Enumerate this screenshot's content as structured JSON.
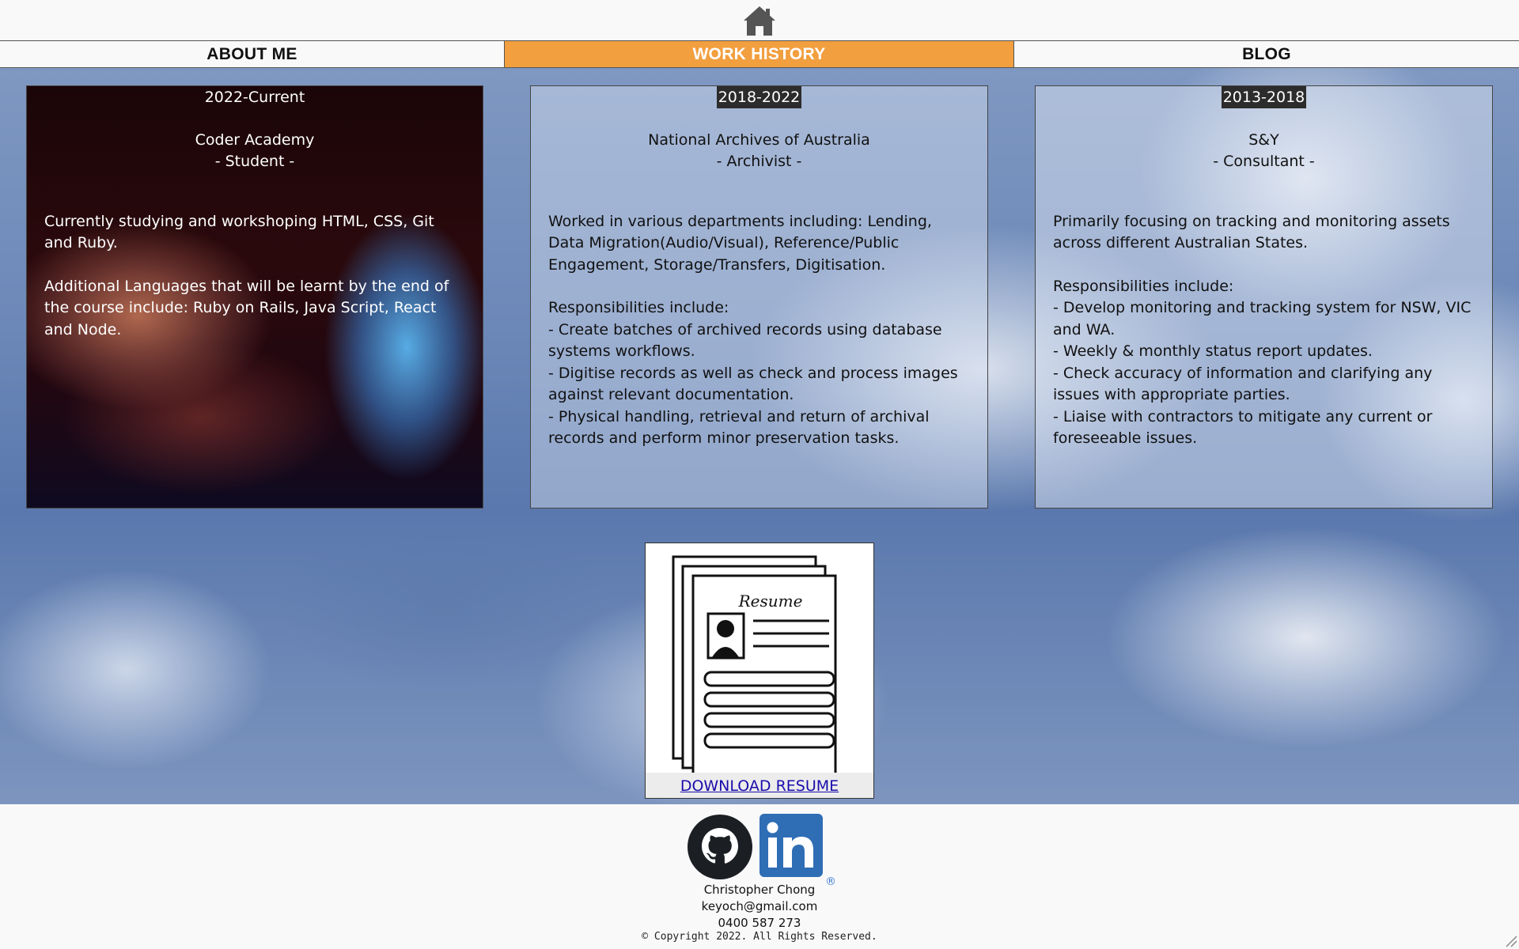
{
  "nav": {
    "items": [
      {
        "label": "ABOUT ME"
      },
      {
        "label": "WORK HISTORY"
      },
      {
        "label": "BLOG"
      }
    ],
    "active_index": 1,
    "active_color": "#f29f3f"
  },
  "icons": {
    "home": "home-icon",
    "github": "github-icon",
    "linkedin": "linkedin-icon",
    "resume": "resume-document-icon"
  },
  "cards": [
    {
      "date": "2022-Current",
      "company": "Coder Academy",
      "role": "- Student -",
      "para1": "Currently studying and workshoping HTML, CSS, Git and Ruby.",
      "para2": "Additional Languages that will be learnt by the end of the course include: Ruby on Rails, Java Script, React and Node."
    },
    {
      "date": "2018-2022",
      "company": "National Archives of Australia",
      "role": "- Archivist -",
      "para1": "Worked in various departments including: Lending, Data Migration(Audio/Visual), Reference/Public Engagement, Storage/Transfers, Digitisation.",
      "resp_heading": "Responsibilities include:",
      "resp": [
        "- Create batches of archived records using database systems workflows.",
        "- Digitise records as well as check and process images against relevant documentation.",
        "- Physical handling, retrieval and return of archival records and perform minor preservation tasks."
      ]
    },
    {
      "date": "2013-2018",
      "company": "S&Y",
      "role": "- Consultant -",
      "para1": "Primarily focusing on tracking and monitoring assets across different Australian States.",
      "resp_heading": "Responsibilities include:",
      "resp": [
        "- Develop monitoring and tracking system for NSW, VIC and WA.",
        "- Weekly & monthly status report updates.",
        "- Check accuracy of information and clarifying any issues with appropriate parties.",
        "- Liaise with contractors to mitigate any current or foreseeable issues."
      ]
    }
  ],
  "resume": {
    "image_title": "Resume",
    "link_label": "DOWNLOAD RESUME"
  },
  "footer": {
    "name": "Christopher Chong",
    "email": "keyoch@gmail.com",
    "phone": "0400 587 273",
    "copyright": "© Copyright 2022. All Rights Reserved.",
    "linkedin_mark": "®"
  }
}
